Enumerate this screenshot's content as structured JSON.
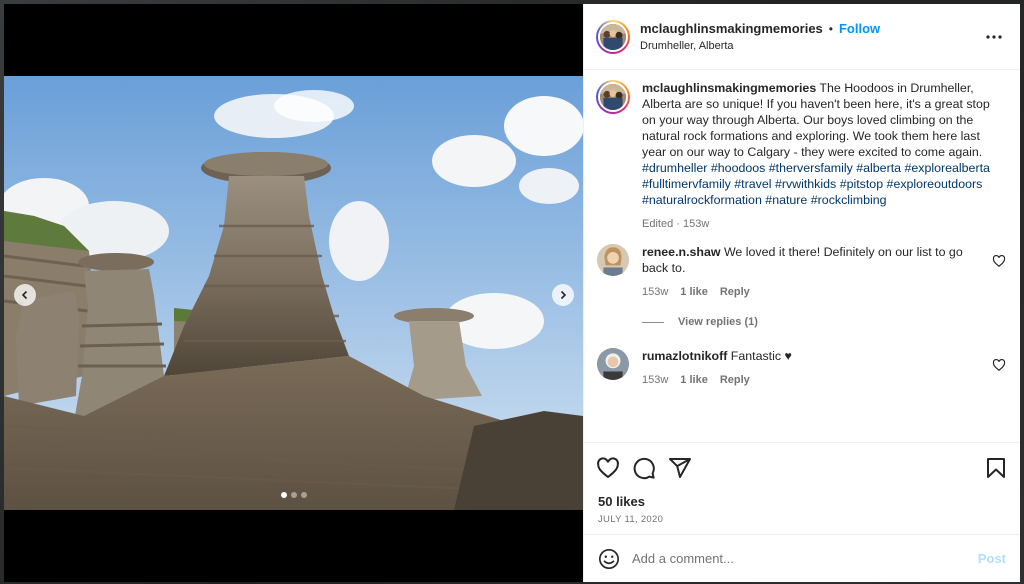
{
  "post": {
    "username": "mclaughlinsmakingmemories",
    "follow_label": "Follow",
    "separator": "•",
    "location": "Drumheller, Alberta",
    "image_alt": "Hoodoo rock formations in Drumheller under a blue sky",
    "carousel": {
      "dots": 3,
      "active": 0
    }
  },
  "caption": {
    "username": "mclaughlinsmakingmemories",
    "text": " The Hoodoos in Drumheller, Alberta are so unique! If you haven't been here, it's a great stop on your way through Alberta. Our boys loved climbing on the natural rock formations and exploring. We took them here last year on our way to Calgary - they were excited to come again. ",
    "hashtags": [
      "#drumheller",
      "#hoodoos",
      "#therversfamily",
      "#alberta",
      "#explorealberta",
      "#fulltimervfamily",
      "#travel",
      "#rvwithkids",
      "#pitstop",
      "#exploreoutdoors",
      "#naturalrockformation",
      "#nature",
      "#rockclimbing"
    ],
    "meta": "Edited · 153w"
  },
  "comments": [
    {
      "username": "renee.n.shaw",
      "text": " We loved it there! Definitely on our list to go back to.",
      "age": "153w",
      "likes": "1 like",
      "reply": "Reply",
      "view_replies": "View replies (1)"
    },
    {
      "username": "rumazlotnikoff",
      "text": " Fantastic ♥",
      "age": "153w",
      "likes": "1 like",
      "reply": "Reply"
    }
  ],
  "footer": {
    "likes": "50 likes",
    "date": "JULY 11, 2020",
    "comment_placeholder": "Add a comment...",
    "post_label": "Post"
  },
  "icons": {
    "nav_prev": "chevron-left-icon",
    "nav_next": "chevron-right-icon",
    "more": "more-options-icon",
    "like": "heart-icon",
    "comment": "comment-icon",
    "share": "share-icon",
    "save": "bookmark-icon",
    "emoji": "emoji-icon"
  },
  "colors": {
    "link": "#0095f6",
    "hashtag": "#00376b",
    "muted": "#737373",
    "post_disabled": "#b2dffc"
  }
}
